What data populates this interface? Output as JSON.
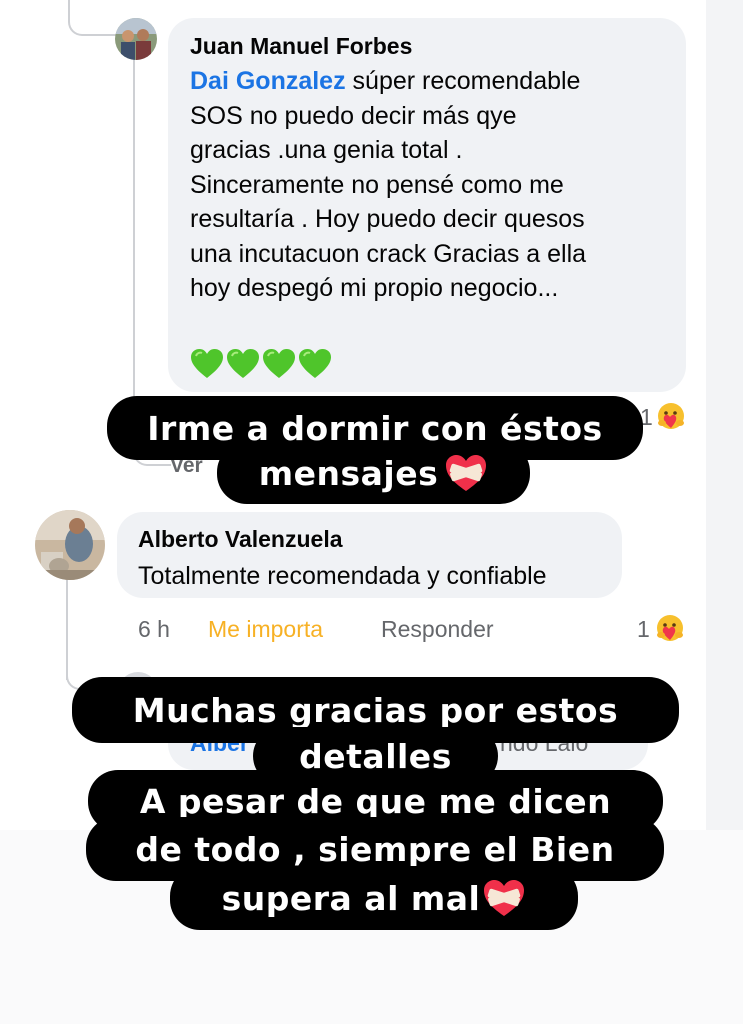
{
  "comments": [
    {
      "author": "Juan Manuel Forbes",
      "mention": "Dai Gonzalez",
      "lines": [
        " súper recomendable",
        "SOS no puedo decir más qye",
        "gracias .una genia total .",
        "Sinceramente no pensé como me",
        "resultaría . Hoy  puedo decir quesos",
        "una incutacuon crack Gracias a ella",
        "hoy despegó  mi propio negocio..."
      ],
      "emoji": [
        "green-heart",
        "green-heart",
        "green-heart",
        "green-heart"
      ],
      "reaction_count": "1",
      "view_replies_partial": "Ver"
    },
    {
      "author": "Alberto Valenzuela",
      "text": "Totalmente recomendada y confiable",
      "time": "6 h",
      "like_label": "Me importa",
      "reply_label": "Responder",
      "reaction_count": "1",
      "reaction_icon": "care-reaction-icon"
    }
  ],
  "partial_reply": {
    "left": "Alber",
    "right": "ndo Lalo"
  },
  "captions": {
    "first": [
      "Irme a dormir con éstos",
      "mensajes"
    ],
    "second": [
      "Muchas gracias por estos",
      "detalles",
      "A pesar de que me dicen",
      "de todo , siempre el Bien",
      "supera al mal"
    ]
  },
  "colors": {
    "mention": "#1b74e4",
    "like_active": "#f7b125",
    "bubble": "#f0f2f5",
    "caption_bg": "#000000"
  }
}
